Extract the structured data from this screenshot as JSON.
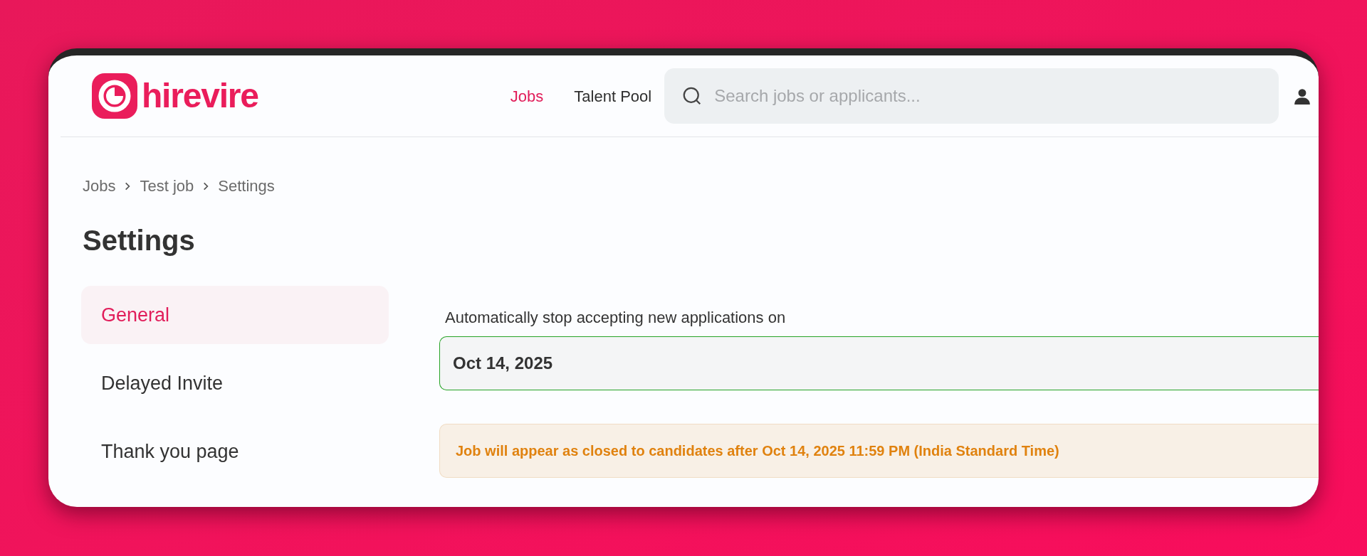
{
  "logo": {
    "text": "hirevire"
  },
  "nav": [
    {
      "label": "Jobs",
      "selected": true
    },
    {
      "label": "Talent Pool",
      "selected": false
    }
  ],
  "search": {
    "placeholder": "Search jobs or applicants..."
  },
  "breadcrumb": [
    "Jobs",
    "Test job",
    "Settings"
  ],
  "title": "Settings",
  "sidebar": {
    "items": [
      {
        "label": "General",
        "selected": true
      },
      {
        "label": "Delayed Invite",
        "selected": false
      },
      {
        "label": "Thank you page",
        "selected": false
      }
    ]
  },
  "close_date": {
    "label": "Automatically stop accepting new applications on",
    "value": "Oct 14, 2025"
  },
  "notice": "Job will appear as closed to candidates after Oct 14, 2025 11:59 PM (India Standard Time)"
}
